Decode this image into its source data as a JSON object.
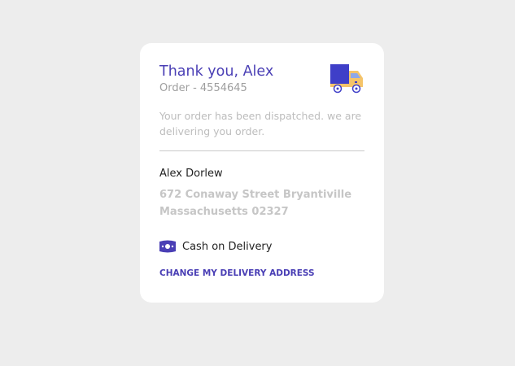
{
  "order": {
    "title": "Thank you, Alex",
    "order_number": "Order - 4554645",
    "message": "Your order has been dispatched. we are delivering you order.",
    "icon": "delivery-truck-icon"
  },
  "customer": {
    "name": "Alex Dorlew",
    "address_line1": "672 Conaway Street Bryantiville",
    "address_line2": "Massachusetts 02327"
  },
  "payment": {
    "icon": "cash-icon",
    "method": "Cash on Delivery"
  },
  "actions": {
    "change_address_label": "CHANGE MY DELIVERY ADDRESS"
  },
  "colors": {
    "accent": "#4a3fb5",
    "background": "#ededed",
    "card": "#ffffff",
    "muted_text": "#bdbdbd"
  }
}
